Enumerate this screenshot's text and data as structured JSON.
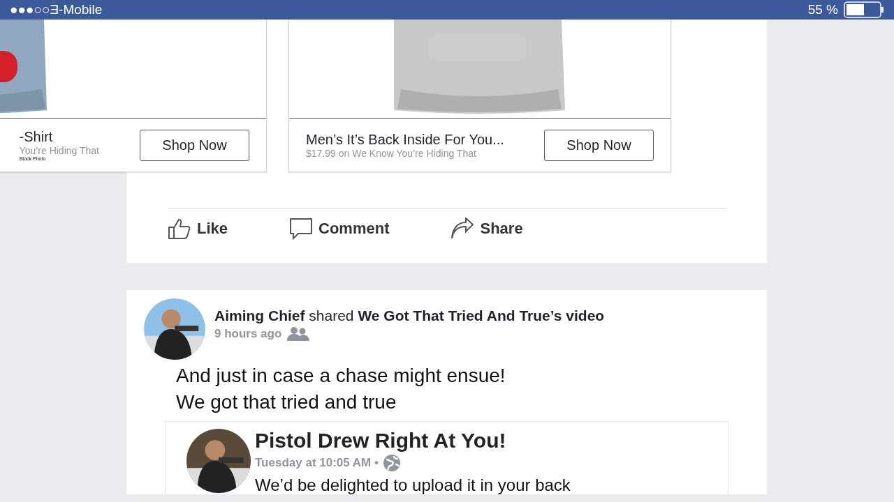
{
  "status_bar": {
    "carrier": "●●●○○Ǝ-Mobile",
    "battery_text": "55 %"
  },
  "ad_post": {
    "products": [
      {
        "title": "-Shirt",
        "subtitle": "You’re Hiding That",
        "caption": "Stock Photo",
        "button": "Shop Now"
      },
      {
        "title": "Men’s It’s Back Inside For You...",
        "subtitle": "$17.99 on We Know You’re Hiding That",
        "button": "Shop Now"
      }
    ],
    "actions": [
      {
        "kind": "like",
        "label": "Like"
      },
      {
        "kind": "comment",
        "label": "Comment"
      },
      {
        "kind": "share",
        "label": "Share"
      }
    ]
  },
  "post": {
    "author": "Aiming Chief",
    "verb": "shared",
    "target": "We Got That Tried And True’s video",
    "time": "9 hours ago",
    "audience": {
      "kind": "friends"
    },
    "text": [
      "And just in case a chase might ensue!",
      "We got that tried and true"
    ],
    "shared": {
      "title": "Pistol Drew Right At You!",
      "time": "Tuesday at 10:05 AM •",
      "audience": {
        "kind": "public"
      },
      "text": "We’d be delighted to upload it in your back"
    }
  }
}
